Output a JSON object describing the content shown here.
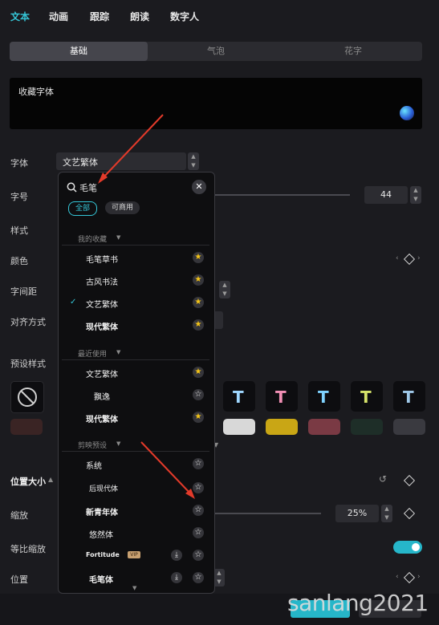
{
  "tabs": [
    "文本",
    "动画",
    "跟踪",
    "朗读",
    "数字人"
  ],
  "segments": [
    "基础",
    "气泡",
    "花字"
  ],
  "favorites": {
    "label": "收藏字体"
  },
  "labels": {
    "font": "字体",
    "size": "字号",
    "style": "样式",
    "color": "颜色",
    "spacing": "字间距",
    "align": "对齐方式",
    "presets": "预设样式",
    "position_size": "位置大小",
    "scale": "缩放",
    "uniform_scale": "等比缩放",
    "position": "位置"
  },
  "font_select": {
    "value": "文艺繁体"
  },
  "size_value": "44",
  "scale_value": "25%",
  "popup": {
    "search_value": "毛笔",
    "filter_all": "全部",
    "filter_commercial": "可商用",
    "section_favorites": "我的收藏",
    "section_recent": "最近使用",
    "section_presets": "剪映预设",
    "favorites": [
      {
        "name": "毛笔草书",
        "starred": true,
        "checked": false
      },
      {
        "name": "古风书法",
        "starred": true,
        "checked": false
      },
      {
        "name": "文艺繁体",
        "starred": true,
        "checked": true
      },
      {
        "name": "现代繁体",
        "starred": true,
        "checked": false
      }
    ],
    "recent": [
      {
        "name": "文艺繁体",
        "starred": true
      },
      {
        "name": "飘逸",
        "starred": false
      },
      {
        "name": "现代繁体",
        "starred": true
      }
    ],
    "presets": [
      {
        "name": "系统",
        "starred": false,
        "download": false
      },
      {
        "name": "后现代体",
        "starred": false,
        "download": false
      },
      {
        "name": "新青年体",
        "starred": false,
        "download": false
      },
      {
        "name": "悠然体",
        "starred": false,
        "download": false
      },
      {
        "name": "Fortitude",
        "starred": false,
        "download": true,
        "badge": "VIP"
      },
      {
        "name": "毛笔体",
        "starred": false,
        "download": true
      }
    ]
  },
  "watermark": "sanlang2021",
  "colors": {
    "accent": "#35c7d8",
    "toggle": "#26b6c9",
    "star": "#f5c518",
    "arrow": "#e23a2a"
  }
}
